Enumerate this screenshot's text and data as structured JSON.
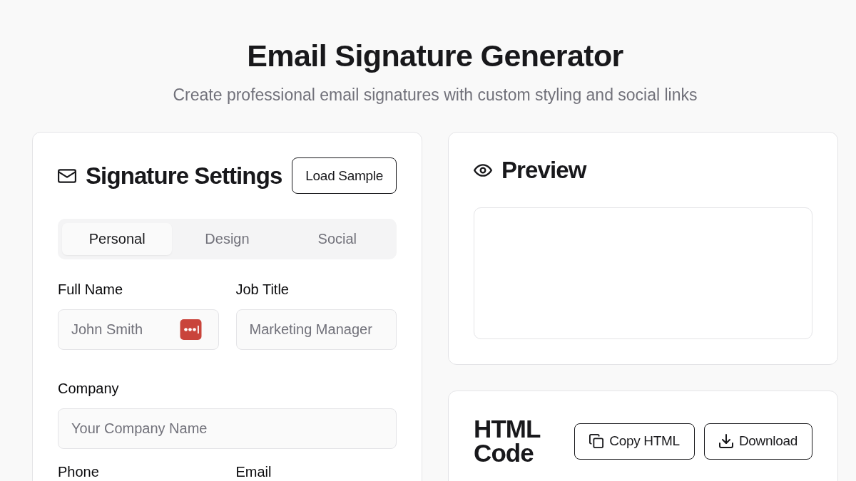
{
  "header": {
    "title": "Email Signature Generator",
    "subtitle": "Create professional email signatures with custom styling and social links"
  },
  "settings": {
    "title": "Signature Settings",
    "load_button": "Load Sample",
    "tabs": [
      {
        "label": "Personal",
        "selected": true
      },
      {
        "label": "Design",
        "selected": false
      },
      {
        "label": "Social",
        "selected": false
      }
    ],
    "field_rows": [
      {
        "fields": [
          {
            "label": "Full Name",
            "placeholder": "John Smith",
            "autofill_icon": true
          },
          {
            "label": "Job Title",
            "placeholder": "Marketing Manager",
            "autofill_icon": false
          }
        ]
      },
      {
        "fields": [
          {
            "label": "Company",
            "placeholder": "Your Company Name",
            "autofill_icon": false
          }
        ]
      },
      {
        "fields": [
          {
            "label": "Phone"
          },
          {
            "label": "Email"
          }
        ]
      }
    ]
  },
  "preview": {
    "title": "Preview"
  },
  "html_code": {
    "title": "HTML Code",
    "buttons": [
      {
        "label": "Copy HTML",
        "kind": "copy"
      },
      {
        "label": "Download",
        "kind": "download"
      }
    ]
  }
}
